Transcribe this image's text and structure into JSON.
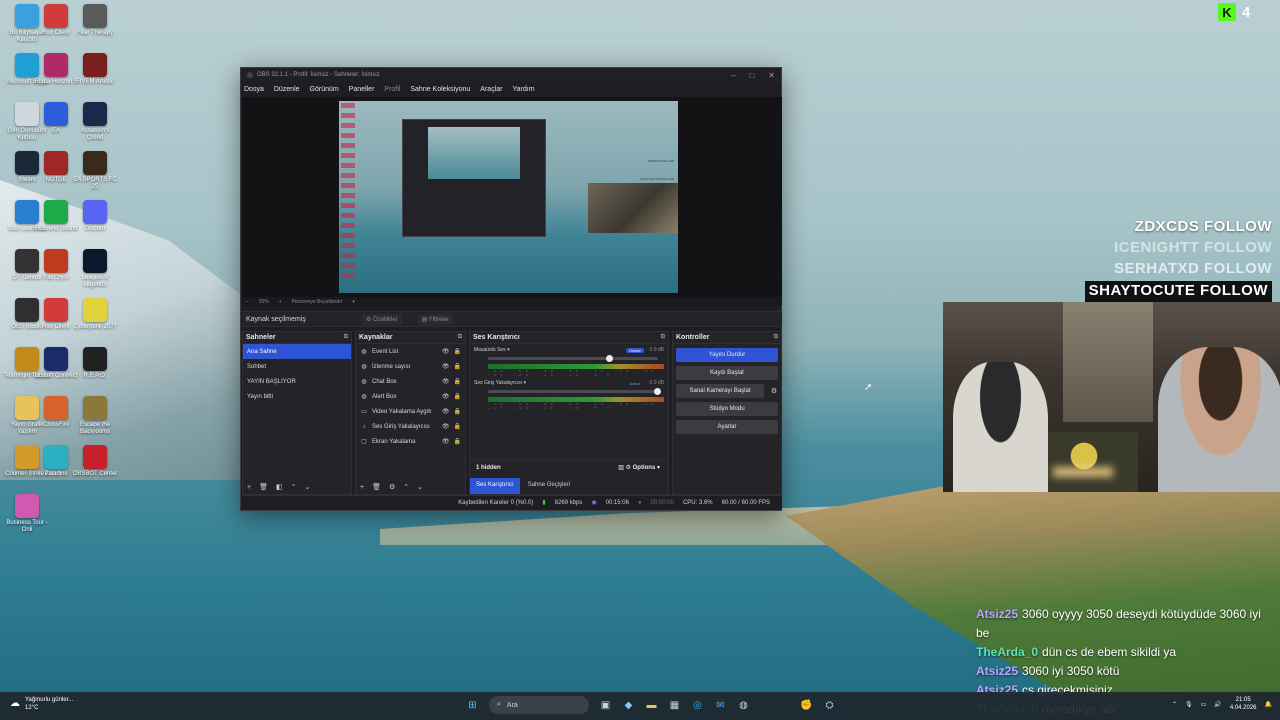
{
  "overlay": {
    "kick_count": "4",
    "follows": [
      {
        "text": "ZDXCDS  FOLLOW"
      },
      {
        "text": "ICENIGHTT  FOLLOW"
      },
      {
        "text": "SERHATXD  FOLLOW"
      },
      {
        "text": "SHAYTOCUTE  FOLLOW"
      }
    ],
    "chat": [
      {
        "user": "Atsiz25",
        "msg": "3060 oyyyy 3050 deseydi kötüydüde 3060 iyi be",
        "color": "#b9a6ff"
      },
      {
        "user": "TheArda_0",
        "msg": "dün cs de ebem sikildi ya",
        "color": "#62e0b8"
      },
      {
        "user": "Atsiz25",
        "msg": "3060 iyi 3050 kötü",
        "color": "#b9a6ff"
      },
      {
        "user": "Atsiz25",
        "msg": "cs girecekmisiniz",
        "color": "#b9a6ff"
      },
      {
        "user": "TheArda_0",
        "msg": "oynadıkya abi",
        "color": "#62e0b8"
      }
    ]
  },
  "desktop_icons": [
    {
      "label": "Bu Bilgisayar Klasörü",
      "color": "#3aa0e0",
      "icon": "computer-icon"
    },
    {
      "label": "Riot Client",
      "color": "#d13b3b",
      "icon": "riot-icon"
    },
    {
      "label": "Fear Therapy",
      "color": "#5a5a5a",
      "icon": "game-icon"
    },
    {
      "label": "Microsoft Edge",
      "color": "#1f9fd6",
      "icon": "edge-icon"
    },
    {
      "label": "Forza Horizon 5",
      "color": "#b02a6a",
      "icon": "game-icon"
    },
    {
      "label": "FIVEM Artistic",
      "color": "#7a1e1e",
      "icon": "game-icon"
    },
    {
      "label": "Geri Dönüşüm Kutusu",
      "color": "#d0d8de",
      "icon": "recycle-bin-icon"
    },
    {
      "label": "EA",
      "color": "#2b5fd9",
      "icon": "ea-icon"
    },
    {
      "label": "Assassin's Creed",
      "color": "#1b2a4a",
      "icon": "game-icon"
    },
    {
      "label": "Steam",
      "color": "#1b2838",
      "icon": "steam-icon"
    },
    {
      "label": "NOTDE",
      "color": "#a12626",
      "icon": "game-icon"
    },
    {
      "label": "EA SPORTS FC 25",
      "color": "#3a2a1a",
      "icon": "game-icon"
    },
    {
      "label": "Valo Launcher",
      "color": "#2a7fd0",
      "icon": "app-icon"
    },
    {
      "label": "FxSound Sound",
      "color": "#1faa4a",
      "icon": "sound-icon"
    },
    {
      "label": "Discord",
      "color": "#5865f2",
      "icon": "discord-icon"
    },
    {
      "label": "DT Control",
      "color": "#333",
      "icon": "app-icon"
    },
    {
      "label": "Far Cry 6",
      "color": "#c03a20",
      "icon": "game-icon"
    },
    {
      "label": "League of Legends",
      "color": "#0a1a2a",
      "icon": "lol-icon"
    },
    {
      "label": "OBS Studio",
      "color": "#302e31",
      "icon": "obs-icon"
    },
    {
      "label": "Riot Client",
      "color": "#d13b3b",
      "icon": "riot-icon"
    },
    {
      "label": "Cyberpunk 2077",
      "color": "#e0d23a",
      "icon": "game-icon"
    },
    {
      "label": "Teamfight Tactics",
      "color": "#c28a1a",
      "icon": "tft-icon"
    },
    {
      "label": "Ubisoft Connect",
      "color": "#1a2a6a",
      "icon": "ubisoft-icon"
    },
    {
      "label": "R.E.P.O.",
      "color": "#222",
      "icon": "game-icon"
    },
    {
      "label": "Yayın Grafik Yazılım",
      "color": "#e8c25a",
      "icon": "folder-icon"
    },
    {
      "label": "CrossFire",
      "color": "#d8632a",
      "icon": "game-icon"
    },
    {
      "label": "Escape the Backrooms",
      "color": "#8a7a3a",
      "icon": "game-icon"
    },
    {
      "label": "Counter-Strike 2",
      "color": "#d49a2a",
      "icon": "cs2-icon"
    },
    {
      "label": "Paladins",
      "color": "#2ab0c0",
      "icon": "game-icon"
    },
    {
      "label": "OBSBOT Center",
      "color": "#c8202a",
      "icon": "app-icon"
    },
    {
      "label": "Business Tour - Onli",
      "color": "#d05ab0",
      "icon": "game-icon"
    }
  ],
  "obs": {
    "title": "OBS 32.1.1 - Profil: İsimsiz - Sahneler: İsimsiz",
    "menu": [
      "Dosya",
      "Düzenle",
      "Görünüm",
      "Paneller",
      "Profil",
      "Sahne Koleksiyonu",
      "Araçlar",
      "Yardım"
    ],
    "zoom": "26%",
    "zoom_label": "Pencereye Boyutlandır",
    "no_source": "Kaynak seçilmemiş",
    "props_btn": "Özellikler",
    "filters_btn": "Filtreler",
    "preview_texts": [
      "ZDXCDS  FOLLOW",
      "SHAYTOCUTE  FOLLOW"
    ],
    "scenes_title": "Sahneler",
    "scenes": [
      "Ana Sahne",
      "Sohbet",
      "YAYIN BAŞLIYOR",
      "Yayın bitti"
    ],
    "sources_title": "Kaynaklar",
    "sources": [
      {
        "label": "Event List",
        "icon": "globe-icon"
      },
      {
        "label": "İzlenme sayısı",
        "icon": "globe-icon"
      },
      {
        "label": "Chat Box",
        "icon": "globe-icon"
      },
      {
        "label": "Alert Box",
        "icon": "globe-icon"
      },
      {
        "label": "Video Yakalama Aygıtı",
        "icon": "camera-icon"
      },
      {
        "label": "Ses Giriş Yakalayıcısı",
        "icon": "mic-icon"
      },
      {
        "label": "Ekran Yakalama",
        "icon": "monitor-icon"
      }
    ],
    "mixer_title": "Ses Karıştırıcı",
    "mixer": [
      {
        "name": "Masaüstü Ses",
        "tag": "Global",
        "db": "0.0 dB",
        "level": 0.72,
        "peak": 0.2
      },
      {
        "name": "Ses Giriş Yakalayıcısı",
        "tag": "Active",
        "db": "0.0 dB",
        "level": 1.0,
        "peak": 0.65
      }
    ],
    "ticks": "-60 -55 -50 -45 -40 -35 -30 -25 -20 -15 -10 -5 0",
    "hidden": "1 hidden",
    "options": "Options",
    "tab_mixer": "Ses Karıştırıcı",
    "tab_transitions": "Sahne Geçişleri",
    "controls_title": "Kontroller",
    "controls": {
      "stop_stream": "Yayını Durdur",
      "start_record": "Kaydı Başlat",
      "virtual_cam": "Sanal Kamerayı Başlat",
      "studio_mode": "Stüdyo Modu",
      "settings": "Ayarlar"
    },
    "status": {
      "dropped": "Kaybedilen Kareler 0 (%0.0)",
      "bitrate": "8269 kbps",
      "stream_time": "00:15:06",
      "rec_time": "00:00:00",
      "cpu": "CPU: 3.6%",
      "fps": "60.00 / 60.00 FPS"
    }
  },
  "taskbar": {
    "weather_line1": "Yağmurlu günler...",
    "weather_line2": "12°C",
    "search": "Ara",
    "time": "21:05",
    "date": "4.04.2026"
  }
}
